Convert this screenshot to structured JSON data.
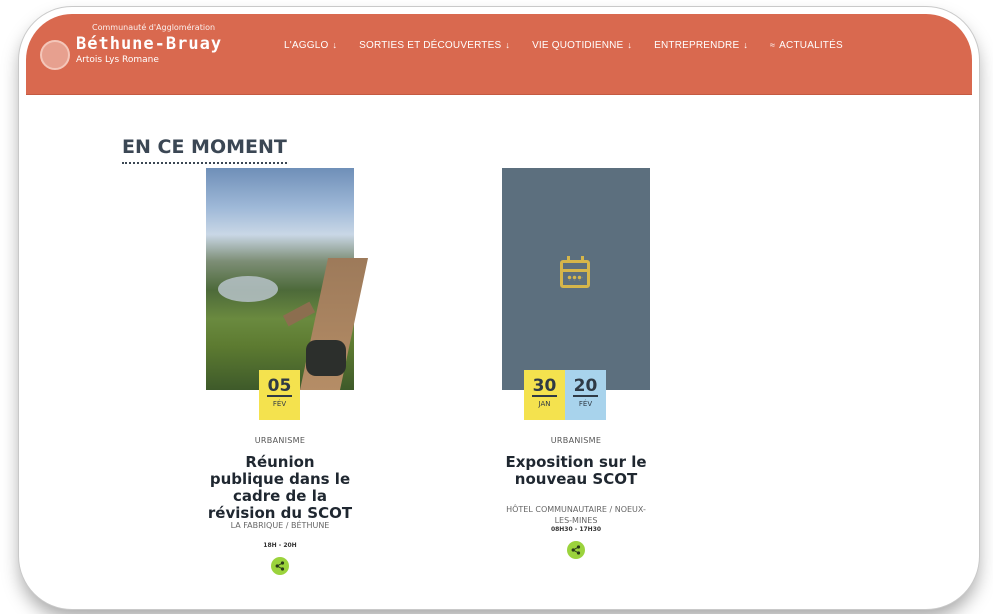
{
  "header": {
    "brand_line1": "Communauté d'Agglomération",
    "brand_name": "Béthune-Bruay",
    "brand_line3": "Artois Lys Romane"
  },
  "nav": [
    {
      "label": "L'Agglo",
      "icon": "chevron-down-icon"
    },
    {
      "label": "Sorties et découvertes",
      "icon": "chevron-down-icon"
    },
    {
      "label": "Vie quotidienne",
      "icon": "chevron-down-icon"
    },
    {
      "label": "Entreprendre",
      "icon": "chevron-down-icon"
    },
    {
      "label": "Actualités",
      "icon": "rss-icon"
    }
  ],
  "section": {
    "title": "EN CE MOMENT"
  },
  "events": [
    {
      "image": "photo-landscape",
      "dates": [
        {
          "day": "05",
          "month": "FÉV",
          "color": "#f4e24e"
        }
      ],
      "category": "URBANISME",
      "title": "Réunion publique dans le cadre de la révision du SCOT",
      "location": "LA FABRIQUE / BÉTHUNE",
      "time": "18H - 20H"
    },
    {
      "image": "calendar-icon",
      "dates": [
        {
          "day": "30",
          "month": "JAN",
          "color": "#f4e24e"
        },
        {
          "day": "20",
          "month": "FÉV",
          "color": "#a8d3ec"
        }
      ],
      "category": "URBANISME",
      "title": "Exposition sur le nouveau SCOT",
      "location": "HÔTEL COMMUNAUTAIRE / NOEUX-LES-MINES",
      "time": "08H30 - 17H30"
    }
  ],
  "colors": {
    "header_bg": "#d9694f",
    "share_button": "#9bd33c",
    "date_yellow": "#f4e24e",
    "date_blue": "#a8d3ec",
    "placeholder_bg": "#5c6f7e"
  }
}
